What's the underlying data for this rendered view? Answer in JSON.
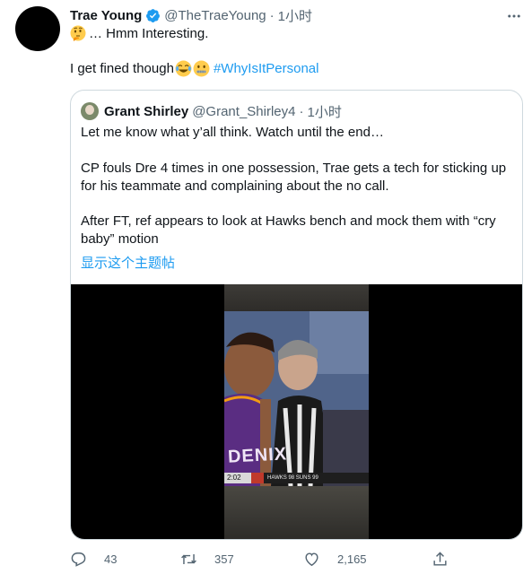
{
  "tweet": {
    "author_name": "Trae Young",
    "handle": "@TheTraeYoung",
    "separator": "·",
    "time": "1小时",
    "text_line1": "… Hmm Interesting.",
    "text_line2": "I get fined though",
    "hashtag": "#WhyIsItPersonal"
  },
  "quote": {
    "author_name": "Grant Shirley",
    "handle": "@Grant_Shirley4",
    "separator": "·",
    "time": "1小时",
    "para1": "Let me know what y’all think. Watch until the end…",
    "para2": "CP fouls Dre 4 times in one possession, Trae gets a tech for sticking up for his teammate and complaining about the no call.",
    "para3": "After FT, ref appears to look at Hawks bench and mock them with “cry baby” motion",
    "show_thread": "显示这个主题帖",
    "video_jersey_text": "DENIX",
    "video_ticker_left": "2:02",
    "video_ticker_right": "HAWKS 98  SUNS 99"
  },
  "actions": {
    "reply_count": "43",
    "retweet_count": "357",
    "like_count": "2,165"
  },
  "colors": {
    "accent": "#1d9bf0",
    "muted": "#536471",
    "border": "#cfd9de"
  },
  "icons": {
    "verified": "verified-badge-icon",
    "more": "more-icon",
    "reply": "reply-icon",
    "retweet": "retweet-icon",
    "like": "heart-icon",
    "share": "share-icon"
  }
}
